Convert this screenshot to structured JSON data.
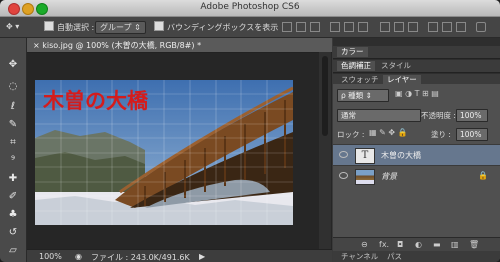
{
  "window": {
    "title": "Adobe Photoshop CS6"
  },
  "options_bar": {
    "auto_select_label": "自動選択 :",
    "auto_select_value": "グループ",
    "transform_label": "バウンディングボックスを表示"
  },
  "document": {
    "tab_label": "kiso.jpg @ 100% (木曽の大橋, RGB/8#)",
    "tab_modified": "*",
    "canvas_text": "木曽の大橋",
    "zoom": "100%",
    "file_info": "ファイル : 243.0K/491.6K"
  },
  "panels": {
    "row1": [
      "カラー"
    ],
    "row2": [
      "色調補正",
      "スタイル"
    ],
    "row3": [
      "スウォッチ",
      "レイヤー"
    ],
    "filter_label": "ρ 種類",
    "blend_mode": "通常",
    "opacity_label": "不透明度 :",
    "opacity_value": "100%",
    "lock_label": "ロック :",
    "fill_label": "塗り :",
    "fill_value": "100%",
    "layers": [
      {
        "name": "木曽の大橋",
        "type": "text"
      },
      {
        "name": "背景",
        "type": "background"
      }
    ],
    "bottom_tabs": [
      "チャンネル",
      "パス"
    ]
  },
  "colors": {
    "accent_text": "#d41c1c",
    "layer_selected": "#66778e"
  }
}
